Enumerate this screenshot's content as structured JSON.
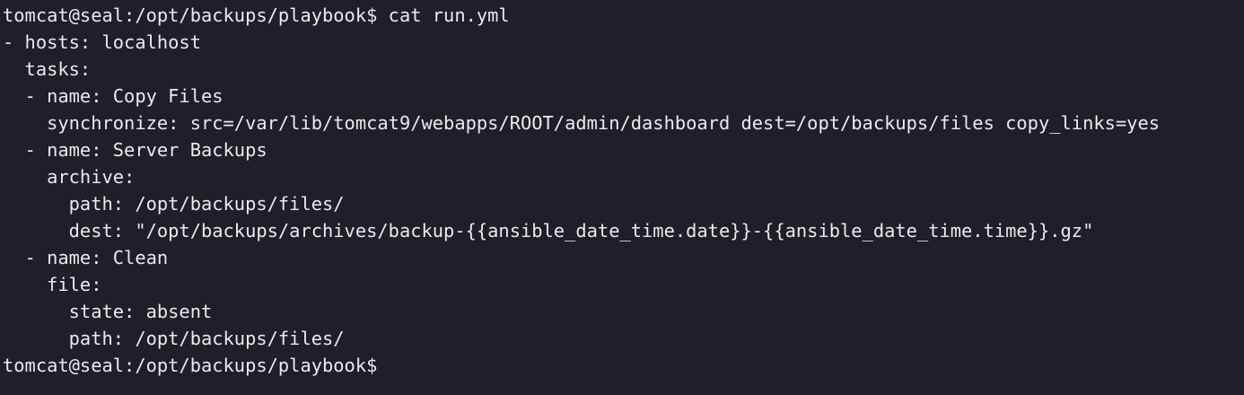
{
  "terminal": {
    "lines": [
      "tomcat@seal:/opt/backups/playbook$ cat run.yml",
      "- hosts: localhost",
      "  tasks:",
      "  - name: Copy Files",
      "    synchronize: src=/var/lib/tomcat9/webapps/ROOT/admin/dashboard dest=/opt/backups/files copy_links=yes",
      "  - name: Server Backups",
      "    archive:",
      "      path: /opt/backups/files/",
      "      dest: \"/opt/backups/archives/backup-{{ansible_date_time.date}}-{{ansible_date_time.time}}.gz\"",
      "  - name: Clean",
      "    file:",
      "      state: absent",
      "      path: /opt/backups/files/",
      "tomcat@seal:/opt/backups/playbook$"
    ]
  }
}
